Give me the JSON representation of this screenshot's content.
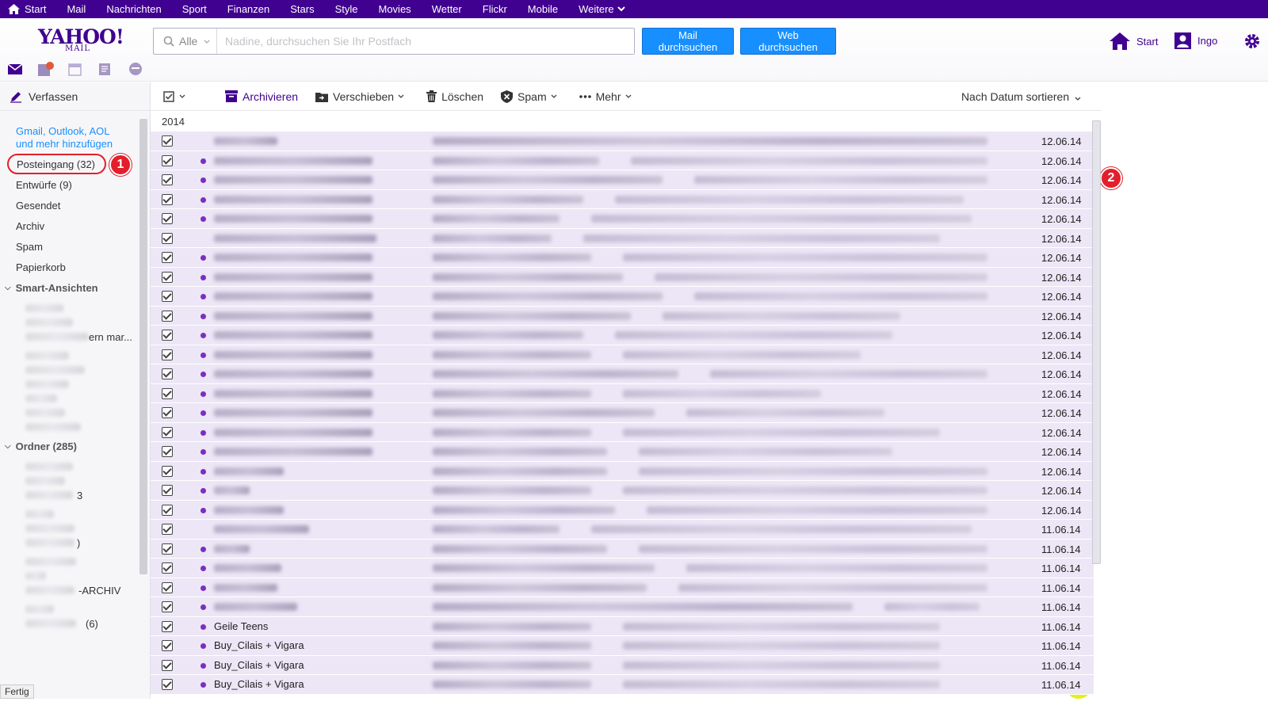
{
  "topnav": {
    "items": [
      "Start",
      "Mail",
      "Nachrichten",
      "Sport",
      "Finanzen",
      "Stars",
      "Style",
      "Movies",
      "Wetter",
      "Flickr",
      "Mobile",
      "Weitere"
    ]
  },
  "header": {
    "logo_big": "YAHOO!",
    "logo_small": "MAIL",
    "search_scope": "Alle",
    "search_placeholder": "Nadine, durchsuchen Sie Ihr Postfach",
    "search_mail_button": "Mail durchsuchen",
    "search_web_button": "Web durchsuchen",
    "home_label": "Start",
    "user_label": "Ingo"
  },
  "sidebar": {
    "compose_label": "Verfassen",
    "add_accounts": "Gmail, Outlook, AOL und mehr hinzufügen",
    "folders": [
      "Posteingang (32)",
      "Entwürfe (9)",
      "Gesendet",
      "Archiv",
      "Spam",
      "Papierkorb"
    ],
    "smart_views_title": "Smart-Ansichten",
    "smart_views_visible_fragment": "ern mar...",
    "folders_title": "Ordner (285)",
    "folder_fragments": [
      "3",
      ")",
      "-ARCHIV",
      "(6)"
    ]
  },
  "badges": [
    "1",
    "2"
  ],
  "toolbar": {
    "archive": "Archivieren",
    "move": "Verschieben",
    "delete": "Löschen",
    "spam": "Spam",
    "more": "Mehr",
    "sort": "Nach Datum sortieren"
  },
  "list": {
    "year": "2014",
    "rows": [
      {
        "date": "12.06.14",
        "unread": false,
        "from": ""
      },
      {
        "date": "12.06.14",
        "unread": true,
        "from": ""
      },
      {
        "date": "12.06.14",
        "unread": true,
        "from": ""
      },
      {
        "date": "12.06.14",
        "unread": true,
        "from": ""
      },
      {
        "date": "12.06.14",
        "unread": true,
        "from": ""
      },
      {
        "date": "12.06.14",
        "unread": false,
        "from": ""
      },
      {
        "date": "12.06.14",
        "unread": true,
        "from": ""
      },
      {
        "date": "12.06.14",
        "unread": true,
        "from": ""
      },
      {
        "date": "12.06.14",
        "unread": true,
        "from": ""
      },
      {
        "date": "12.06.14",
        "unread": true,
        "from": ""
      },
      {
        "date": "12.06.14",
        "unread": true,
        "from": ""
      },
      {
        "date": "12.06.14",
        "unread": true,
        "from": ""
      },
      {
        "date": "12.06.14",
        "unread": true,
        "from": ""
      },
      {
        "date": "12.06.14",
        "unread": true,
        "from": ""
      },
      {
        "date": "12.06.14",
        "unread": true,
        "from": ""
      },
      {
        "date": "12.06.14",
        "unread": true,
        "from": ""
      },
      {
        "date": "12.06.14",
        "unread": true,
        "from": ""
      },
      {
        "date": "12.06.14",
        "unread": true,
        "from": ""
      },
      {
        "date": "12.06.14",
        "unread": true,
        "from": ""
      },
      {
        "date": "12.06.14",
        "unread": true,
        "from": ""
      },
      {
        "date": "11.06.14",
        "unread": false,
        "from": ""
      },
      {
        "date": "11.06.14",
        "unread": true,
        "from": ""
      },
      {
        "date": "11.06.14",
        "unread": true,
        "from": ""
      },
      {
        "date": "11.06.14",
        "unread": true,
        "from": ""
      },
      {
        "date": "11.06.14",
        "unread": true,
        "from": ""
      },
      {
        "date": "11.06.14",
        "unread": true,
        "from": "Geile Teens"
      },
      {
        "date": "11.06.14",
        "unread": true,
        "from": "Buy_Cilais + Vigara"
      },
      {
        "date": "11.06.14",
        "unread": true,
        "from": "Buy_Cilais + Vigara"
      },
      {
        "date": "11.06.14",
        "unread": true,
        "from": "Buy_Cilais + Vigara"
      }
    ]
  },
  "status_text": "Fertig",
  "colors": {
    "nav": "#400090",
    "accent_blue": "#188fff",
    "highlight": "#e6ee1c",
    "badge_red": "#e21f2a",
    "row_bg": "#ece6f6"
  }
}
